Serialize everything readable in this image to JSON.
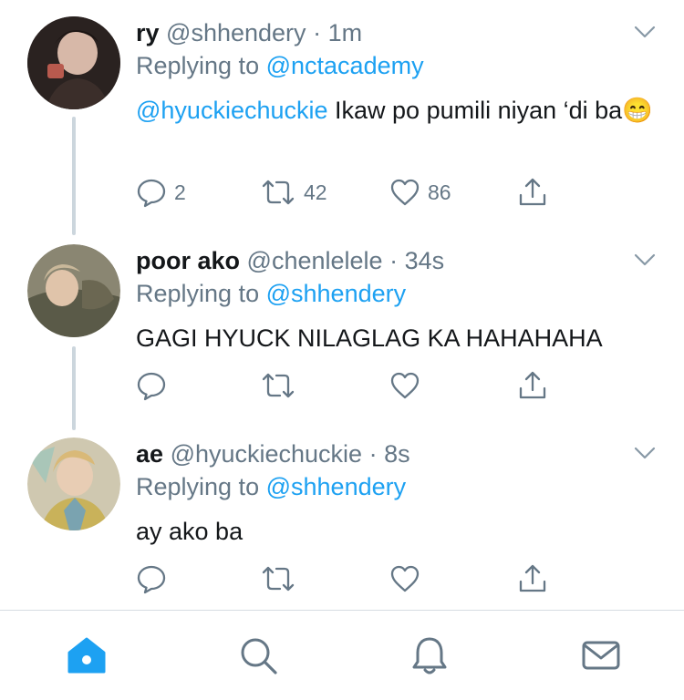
{
  "colors": {
    "accent": "#1da1f2",
    "secondary_text": "#657786",
    "thread_line": "#ccd6dd",
    "icon_grey": "#657786"
  },
  "tweets": [
    {
      "name": "ry",
      "handle": "@shhendery",
      "dot": "·",
      "time": "1m",
      "replying_prefix": "Replying to",
      "replying_to": "@nctacademy",
      "mention": "@hyuckiechuckie",
      "text": " Ikaw po pumili niyan ‘di ba",
      "emoji": "😁",
      "reply_count": "2",
      "retweet_count": "42",
      "like_count": "86"
    },
    {
      "name": "poor ako",
      "handle": "@chenlelele",
      "dot": "·",
      "time": "34s",
      "replying_prefix": "Replying to",
      "replying_to": "@shhendery",
      "text": "GAGI HYUCK NILAGLAG KA HAHAHAHA"
    },
    {
      "name": "ae",
      "handle": "@hyuckiechuckie",
      "dot": "·",
      "time": "8s",
      "replying_prefix": "Replying to",
      "replying_to": "@shhendery",
      "text": "ay ako ba"
    }
  ],
  "tabbar": {
    "active_tab": "home",
    "icons": [
      "home-icon",
      "search-icon",
      "bell-icon",
      "mail-icon"
    ]
  }
}
